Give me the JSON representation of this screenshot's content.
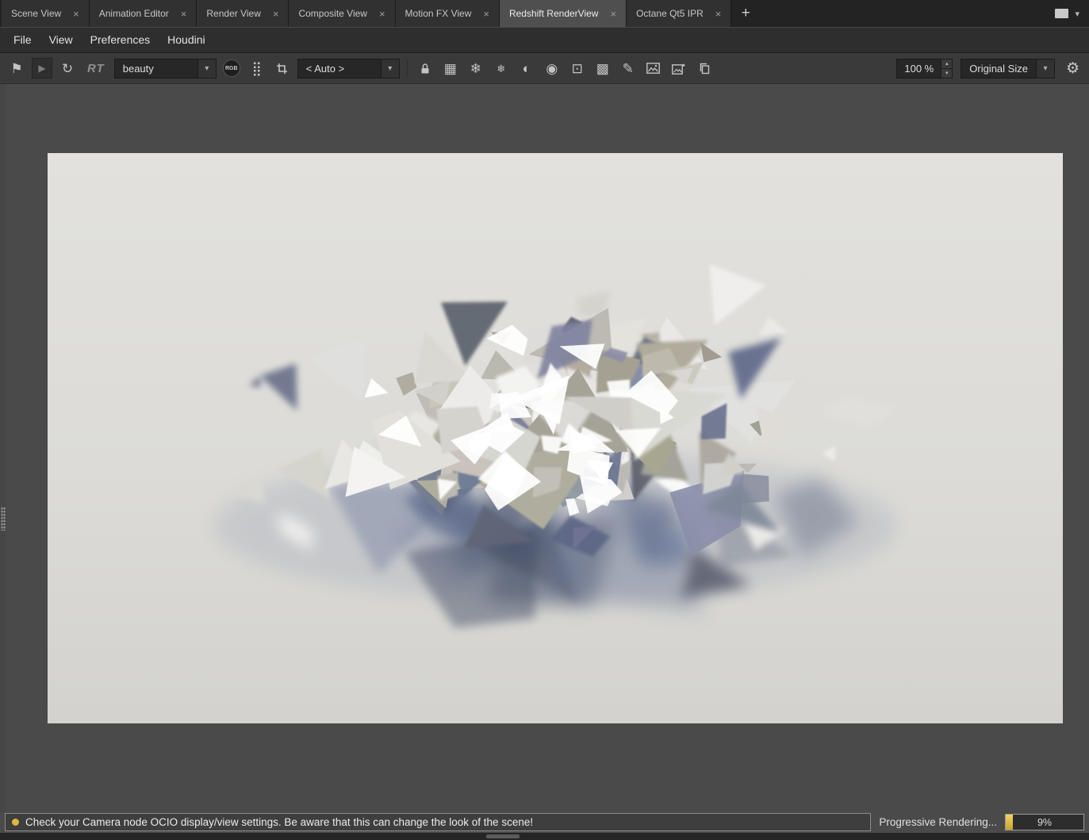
{
  "tabbar": {
    "tabs": [
      "Scene View",
      "Animation Editor",
      "Render View",
      "Composite View",
      "Motion FX View",
      "Redshift RenderView",
      "Octane Qt5 IPR"
    ],
    "active_index": 5,
    "close_glyph": "×",
    "add_glyph": "+"
  },
  "menubar": {
    "items": [
      "File",
      "View",
      "Preferences",
      "Houdini"
    ]
  },
  "toolbar": {
    "rt_label": "RT",
    "aov_dropdown_value": "beauty",
    "rgb_label": "RGB",
    "ocio_dropdown_value": "< Auto >",
    "zoom_value": "100 %",
    "size_dropdown_value": "Original Size"
  },
  "statusbar": {
    "message": "Check your Camera node OCIO display/view settings. Be aware that this can change the look of the scene!",
    "progress_label": "Progressive Rendering...",
    "progress_percent": "9%",
    "progress_fraction": 0.09
  },
  "icons": {
    "snapshot": "⚑",
    "play": "▶",
    "refresh": "↻",
    "dropdown_arrow": "▾",
    "dots_grid": "⣿",
    "grid": "▦",
    "snowflake_a": "❄",
    "snowflake_b": "❄",
    "sphere": "◐",
    "target": "◉",
    "focus": "⊡",
    "fit": "▩",
    "pencil": "✎",
    "gear": "⚙",
    "spinner_up": "▴",
    "spinner_down": "▾"
  },
  "colors": {
    "accent_yellow": "#d9b844",
    "viewport_bg": "#4a4a4a",
    "render_bg": "#dcdbd7"
  },
  "render_view": {
    "alt": "Progressive render: pile of white low-poly rock shards exploding with motion blur on a light gray backdrop"
  }
}
